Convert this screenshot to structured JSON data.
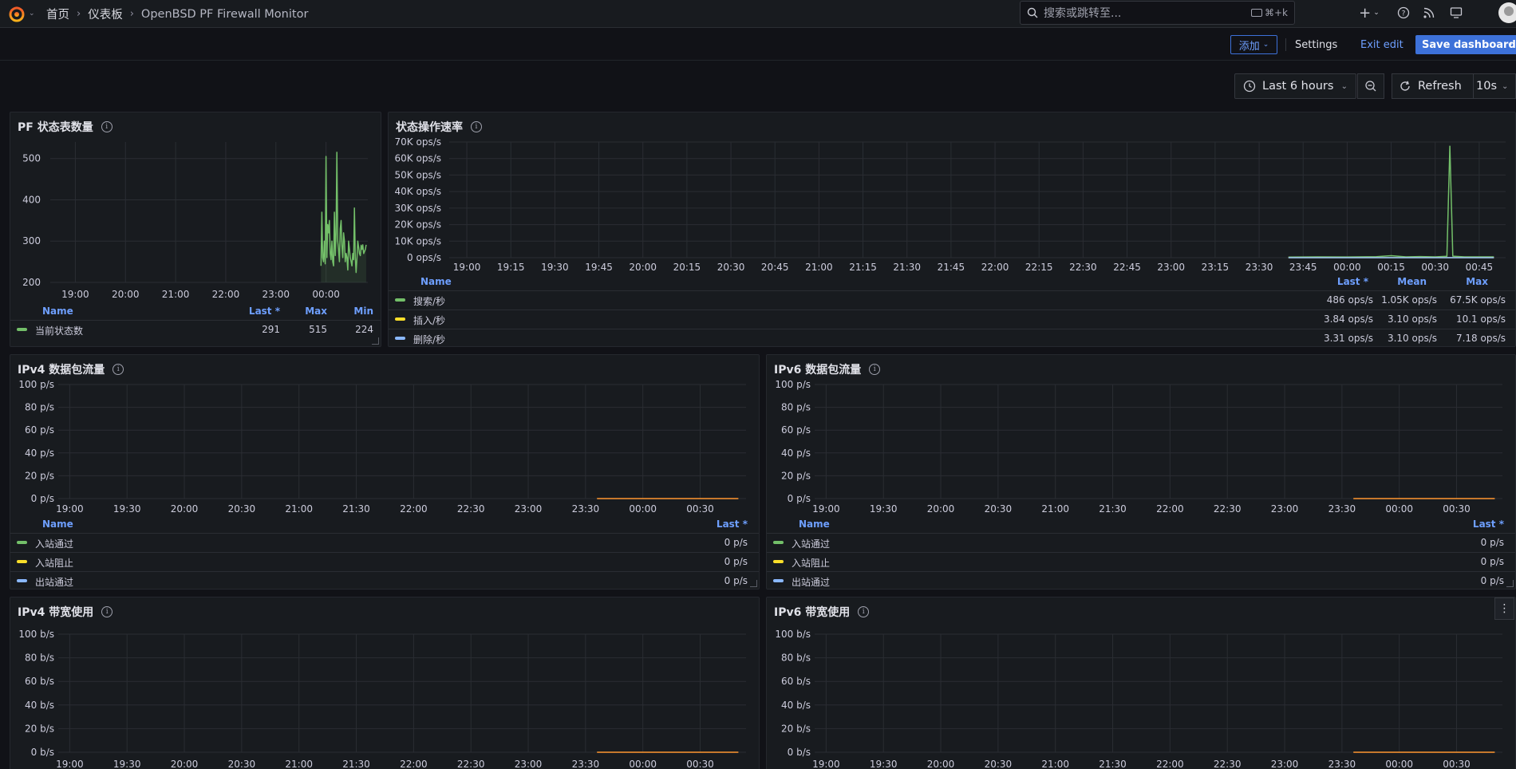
{
  "nav": {
    "breadcrumbs": [
      "首页",
      "仪表板",
      "OpenBSD PF Firewall Monitor"
    ],
    "search_placeholder": "搜索或跳转至...",
    "search_shortcut": "⌘+k"
  },
  "toolbar": {
    "add_label": "添加",
    "settings_label": "Settings",
    "exit_label": "Exit edit",
    "save_label": "Save dashboard"
  },
  "time": {
    "range_label": "Last 6 hours",
    "refresh_label": "Refresh",
    "interval_label": "10s"
  },
  "colors": {
    "green": "#73bf69",
    "yellow": "#fade2a",
    "blue": "#8ab8ff",
    "orange": "#ff9830",
    "accent": "#3d71d9"
  },
  "panels": {
    "states": {
      "title": "PF 状态表数量",
      "legend_headers": [
        "Name",
        "Last *",
        "Max",
        "Min"
      ],
      "legend_rows": [
        {
          "name": "当前状态数",
          "color": "#73bf69",
          "values": [
            "291",
            "515",
            "224"
          ]
        }
      ]
    },
    "ops": {
      "title": "状态操作速率",
      "legend_headers": [
        "Name",
        "Last *",
        "Mean",
        "Max"
      ],
      "legend_rows": [
        {
          "name": "搜索/秒",
          "color": "#73bf69",
          "values": [
            "486 ops/s",
            "1.05K ops/s",
            "67.5K ops/s"
          ]
        },
        {
          "name": "插入/秒",
          "color": "#fade2a",
          "values": [
            "3.84 ops/s",
            "3.10 ops/s",
            "10.1 ops/s"
          ]
        },
        {
          "name": "删除/秒",
          "color": "#8ab8ff",
          "values": [
            "3.31 ops/s",
            "3.10 ops/s",
            "7.18 ops/s"
          ]
        }
      ]
    },
    "ipv4_packets": {
      "title": "IPv4 数据包流量",
      "legend_headers": [
        "Name",
        "Last *"
      ],
      "legend_rows": [
        {
          "name": "入站通过",
          "color": "#73bf69",
          "values": [
            "0 p/s"
          ]
        },
        {
          "name": "入站阻止",
          "color": "#fade2a",
          "values": [
            "0 p/s"
          ]
        },
        {
          "name": "出站通过",
          "color": "#8ab8ff",
          "values": [
            "0 p/s"
          ]
        }
      ]
    },
    "ipv6_packets": {
      "title": "IPv6 数据包流量",
      "legend_headers": [
        "Name",
        "Last *"
      ],
      "legend_rows": [
        {
          "name": "入站通过",
          "color": "#73bf69",
          "values": [
            "0 p/s"
          ]
        },
        {
          "name": "入站阻止",
          "color": "#fade2a",
          "values": [
            "0 p/s"
          ]
        },
        {
          "name": "出站通过",
          "color": "#8ab8ff",
          "values": [
            "0 p/s"
          ]
        }
      ]
    },
    "ipv4_bw": {
      "title": "IPv4 带宽使用"
    },
    "ipv6_bw": {
      "title": "IPv6 带宽使用"
    }
  },
  "chart_data": [
    {
      "id": "states",
      "type": "line",
      "x_ticks": [
        "19:00",
        "20:00",
        "21:00",
        "22:00",
        "23:00",
        "00:00"
      ],
      "y_ticks": [
        "200",
        "300",
        "400",
        "500"
      ],
      "ylim": [
        200,
        540
      ],
      "xlim": [
        "18:30",
        "00:50"
      ],
      "series": [
        {
          "name": "当前状态数",
          "color": "#73bf69",
          "x": [
            "23:54",
            "23:55",
            "23:56",
            "23:57",
            "23:58",
            "23:59",
            "00:00",
            "00:01",
            "00:02",
            "00:03",
            "00:04",
            "00:05",
            "00:06",
            "00:07",
            "00:08",
            "00:09",
            "00:10",
            "00:11",
            "00:12",
            "00:13",
            "00:14",
            "00:15",
            "00:16",
            "00:17",
            "00:18",
            "00:19",
            "00:20",
            "00:21",
            "00:22",
            "00:23",
            "00:24",
            "00:25",
            "00:26",
            "00:27",
            "00:28",
            "00:29",
            "00:30",
            "00:31",
            "00:32",
            "00:33",
            "00:34",
            "00:35",
            "00:36",
            "00:37",
            "00:38",
            "00:39",
            "00:40",
            "00:41",
            "00:42",
            "00:43",
            "00:44",
            "00:45",
            "00:46",
            "00:47",
            "00:48"
          ],
          "values": [
            240,
            370,
            260,
            250,
            300,
            245,
            505,
            260,
            340,
            320,
            350,
            270,
            255,
            300,
            250,
            240,
            370,
            265,
            320,
            515,
            300,
            280,
            250,
            330,
            350,
            290,
            260,
            320,
            300,
            250,
            270,
            260,
            230,
            300,
            280,
            260,
            250,
            240,
            270,
            255,
            380,
            260,
            224,
            260,
            300,
            285,
            270,
            265,
            290,
            280,
            291,
            270,
            275,
            280,
            291
          ]
        }
      ]
    },
    {
      "id": "ops",
      "type": "line",
      "x_ticks": [
        "19:00",
        "19:15",
        "19:30",
        "19:45",
        "20:00",
        "20:15",
        "20:30",
        "20:45",
        "21:00",
        "21:15",
        "21:30",
        "21:45",
        "22:00",
        "22:15",
        "22:30",
        "22:45",
        "23:00",
        "23:15",
        "23:30",
        "23:45",
        "00:00",
        "00:15",
        "00:30",
        "00:45"
      ],
      "y_ticks": [
        "0 ops/s",
        "10K ops/s",
        "20K ops/s",
        "30K ops/s",
        "40K ops/s",
        "50K ops/s",
        "60K ops/s",
        "70K ops/s"
      ],
      "ylim": [
        0,
        70000
      ],
      "xlim": [
        "18:54",
        "00:54"
      ],
      "series": [
        {
          "name": "搜索/秒",
          "color": "#73bf69",
          "x": [
            "23:40",
            "23:50",
            "00:00",
            "00:10",
            "00:15",
            "00:20",
            "00:25",
            "00:30",
            "00:34",
            "00:35",
            "00:36",
            "00:40",
            "00:45",
            "00:50"
          ],
          "values": [
            400,
            500,
            450,
            600,
            1200,
            500,
            700,
            500,
            800,
            67500,
            900,
            500,
            486,
            486
          ]
        },
        {
          "name": "插入/秒",
          "color": "#fade2a",
          "x": [
            "23:40",
            "00:00",
            "00:20",
            "00:50"
          ],
          "values": [
            3.84,
            3.1,
            10.1,
            3.84
          ]
        },
        {
          "name": "删除/秒",
          "color": "#8ab8ff",
          "x": [
            "23:40",
            "00:00",
            "00:20",
            "00:50"
          ],
          "values": [
            3.31,
            3.1,
            7.18,
            3.31
          ]
        }
      ]
    },
    {
      "id": "ipv4_packets",
      "type": "line",
      "x_ticks": [
        "19:00",
        "19:30",
        "20:00",
        "20:30",
        "21:00",
        "21:30",
        "22:00",
        "22:30",
        "23:00",
        "23:30",
        "00:00",
        "00:30"
      ],
      "y_ticks": [
        "0 p/s",
        "20 p/s",
        "40 p/s",
        "60 p/s",
        "80 p/s",
        "100 p/s"
      ],
      "ylim": [
        0,
        100
      ],
      "xlim": [
        "18:54",
        "00:54"
      ],
      "series": [
        {
          "name": "入站阻止",
          "color": "#ff9830",
          "x": [
            "23:36",
            "00:50"
          ],
          "values": [
            0,
            0
          ]
        }
      ]
    },
    {
      "id": "ipv6_packets",
      "type": "line",
      "x_ticks": [
        "19:00",
        "19:30",
        "20:00",
        "20:30",
        "21:00",
        "21:30",
        "22:00",
        "22:30",
        "23:00",
        "23:30",
        "00:00",
        "00:30"
      ],
      "y_ticks": [
        "0 p/s",
        "20 p/s",
        "40 p/s",
        "60 p/s",
        "80 p/s",
        "100 p/s"
      ],
      "ylim": [
        0,
        100
      ],
      "xlim": [
        "18:54",
        "00:54"
      ],
      "series": [
        {
          "name": "入站阻止",
          "color": "#ff9830",
          "x": [
            "23:36",
            "00:50"
          ],
          "values": [
            0,
            0
          ]
        }
      ]
    },
    {
      "id": "ipv4_bw",
      "type": "line",
      "x_ticks": [
        "19:00",
        "19:30",
        "20:00",
        "20:30",
        "21:00",
        "21:30",
        "22:00",
        "22:30",
        "23:00",
        "23:30",
        "00:00",
        "00:30"
      ],
      "y_ticks": [
        "0 b/s",
        "20 b/s",
        "40 b/s",
        "60 b/s",
        "80 b/s",
        "100 b/s"
      ],
      "ylim": [
        0,
        100
      ],
      "xlim": [
        "18:54",
        "00:54"
      ],
      "series": [
        {
          "color": "#ff9830",
          "x": [
            "23:36",
            "00:50"
          ],
          "values": [
            0,
            0
          ]
        }
      ]
    },
    {
      "id": "ipv6_bw",
      "type": "line",
      "x_ticks": [
        "19:00",
        "19:30",
        "20:00",
        "20:30",
        "21:00",
        "21:30",
        "22:00",
        "22:30",
        "23:00",
        "23:30",
        "00:00",
        "00:30"
      ],
      "y_ticks": [
        "0 b/s",
        "20 b/s",
        "40 b/s",
        "60 b/s",
        "80 b/s",
        "100 b/s"
      ],
      "ylim": [
        0,
        100
      ],
      "xlim": [
        "18:54",
        "00:54"
      ],
      "series": [
        {
          "color": "#ff9830",
          "x": [
            "23:36",
            "00:50"
          ],
          "values": [
            0,
            0
          ]
        }
      ]
    }
  ]
}
